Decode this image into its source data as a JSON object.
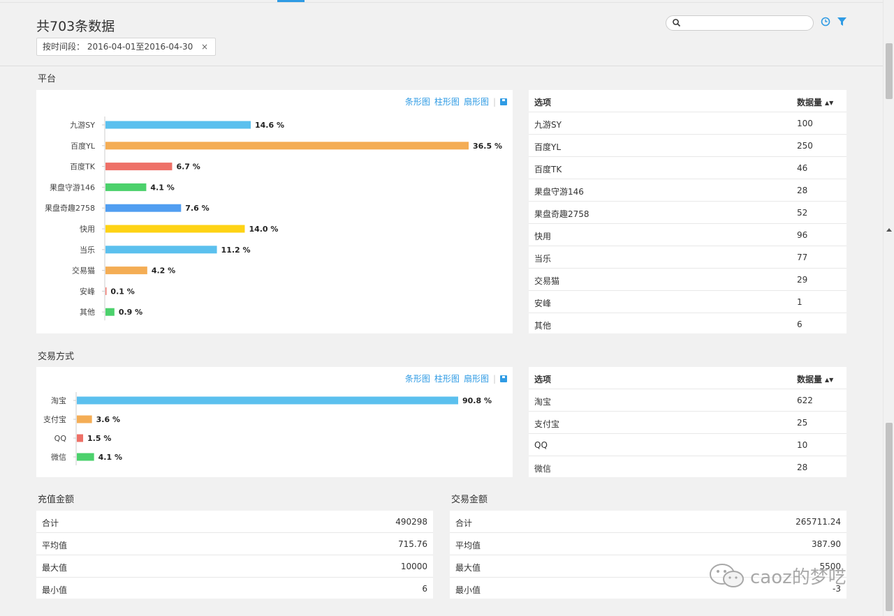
{
  "header": {
    "title": "共703条数据",
    "filter_chip": "按时间段：  2016-04-01至2016-04-30",
    "filter_close": "×",
    "search_placeholder": "",
    "icons": [
      "search-icon",
      "clock-icon",
      "filter-icon"
    ]
  },
  "chart_tabs": {
    "bar_h": "条形图",
    "bar_v": "柱形图",
    "pie": "扇形图",
    "sep": "|"
  },
  "platform": {
    "title": "平台",
    "table_header": {
      "option": "选项",
      "count": "数据量",
      "sort": "▲▼"
    },
    "rows": [
      {
        "name": "九游SY",
        "count": "100"
      },
      {
        "name": "百度YL",
        "count": "250"
      },
      {
        "name": "百度TK",
        "count": "46"
      },
      {
        "name": "果盘守游146",
        "count": "28"
      },
      {
        "name": "果盘奇趣2758",
        "count": "52"
      },
      {
        "name": "快用",
        "count": "96"
      },
      {
        "name": "当乐",
        "count": "77"
      },
      {
        "name": "交易猫",
        "count": "29"
      },
      {
        "name": "安峰",
        "count": "1"
      },
      {
        "name": "其他",
        "count": "6"
      }
    ]
  },
  "payment": {
    "title": "交易方式",
    "table_header": {
      "option": "选项",
      "count": "数据量",
      "sort": "▲▼"
    },
    "rows": [
      {
        "name": "淘宝",
        "count": "622"
      },
      {
        "name": "支付宝",
        "count": "25"
      },
      {
        "name": "QQ",
        "count": "10"
      },
      {
        "name": "微信",
        "count": "28"
      }
    ]
  },
  "chart_data": [
    {
      "type": "bar",
      "orientation": "horizontal",
      "categories": [
        "九游SY",
        "百度YL",
        "百度TK",
        "果盘守游146",
        "果盘奇趣2758",
        "快用",
        "当乐",
        "交易猫",
        "安峰",
        "其他"
      ],
      "values": [
        14.6,
        36.5,
        6.7,
        4.1,
        7.6,
        14.0,
        11.2,
        4.2,
        0.1,
        0.9
      ],
      "labels": [
        "14.6 %",
        "36.5 %",
        "6.7 %",
        "4.1 %",
        "7.6 %",
        "14.0 %",
        "11.2 %",
        "4.2 %",
        "0.1 %",
        "0.9 %"
      ],
      "colors": [
        "#5bc0ee",
        "#f4ad55",
        "#ee7067",
        "#4cd16c",
        "#519ef1",
        "#fed315",
        "#5bc0ee",
        "#f4ad55",
        "#ee7067",
        "#4cd16c"
      ]
    },
    {
      "type": "bar",
      "orientation": "horizontal",
      "categories": [
        "淘宝",
        "支付宝",
        "QQ",
        "微信"
      ],
      "values": [
        90.8,
        3.6,
        1.5,
        4.1
      ],
      "labels": [
        "90.8 %",
        "3.6 %",
        "1.5 %",
        "4.1 %"
      ],
      "colors": [
        "#5bc0ee",
        "#f4ad55",
        "#ee7067",
        "#4cd16c"
      ]
    }
  ],
  "recharge": {
    "title": "充值金额",
    "rows": [
      {
        "label": "合计",
        "value": "490298"
      },
      {
        "label": "平均值",
        "value": "715.76"
      },
      {
        "label": "最大值",
        "value": "10000"
      },
      {
        "label": "最小值",
        "value": "6"
      }
    ]
  },
  "trade": {
    "title": "交易金额",
    "rows": [
      {
        "label": "合计",
        "value": "265711.24"
      },
      {
        "label": "平均值",
        "value": "387.90"
      },
      {
        "label": "最大值",
        "value": "5500"
      },
      {
        "label": "最小值",
        "value": "-3"
      }
    ]
  },
  "watermark": {
    "text": "caoz的梦呓"
  }
}
